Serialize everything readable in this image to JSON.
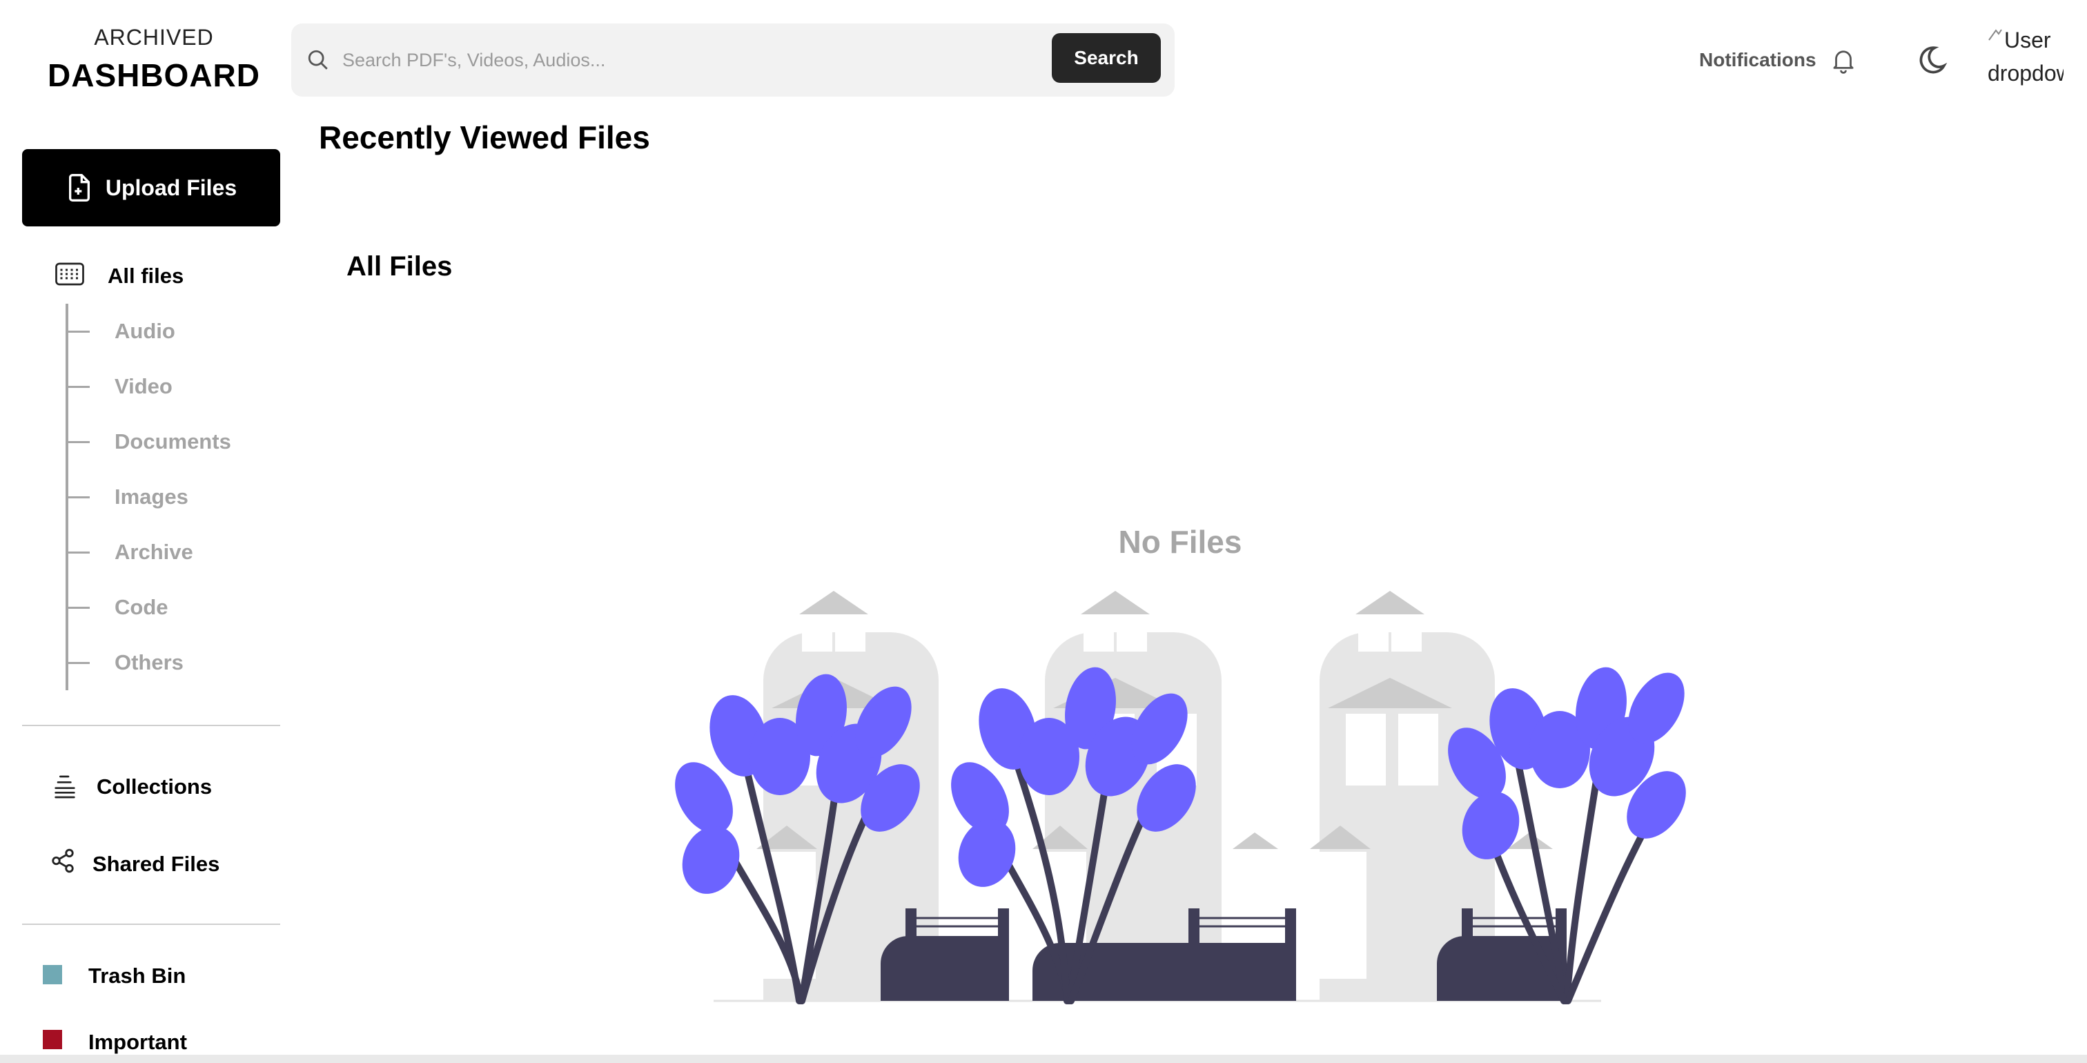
{
  "logo": {
    "top": "ARCHIVED",
    "bottom": "DASHBOARD"
  },
  "search": {
    "placeholder": "Search PDF's, Videos, Audios...",
    "button_label": "Search",
    "icon": "search-icon"
  },
  "header": {
    "notifications_label": "Notifications",
    "notifications_icon": "bell-icon",
    "theme_icon": "moon-icon",
    "user_alt_text": "User dropdown"
  },
  "sidebar": {
    "upload_label": "Upload Files",
    "upload_icon": "file-plus-icon",
    "all_files_label": "All files",
    "all_files_icon": "grid-icon",
    "categories": [
      "Audio",
      "Video",
      "Documents",
      "Images",
      "Archive",
      "Code",
      "Others"
    ],
    "collections_label": "Collections",
    "collections_icon": "stack-icon",
    "shared_label": "Shared Files",
    "shared_icon": "share-icon",
    "tags": [
      {
        "label": "Trash Bin",
        "color": "#70a9b4"
      },
      {
        "label": "Important",
        "color": "#a50f23"
      }
    ]
  },
  "main": {
    "recent_title": "Recently Viewed Files",
    "all_files_title": "All Files",
    "empty_state": "No Files"
  },
  "colors": {
    "accent": "#6c63ff",
    "dark": "#3f3d56",
    "building": "#e6e6e6",
    "roof": "#cccccc"
  }
}
